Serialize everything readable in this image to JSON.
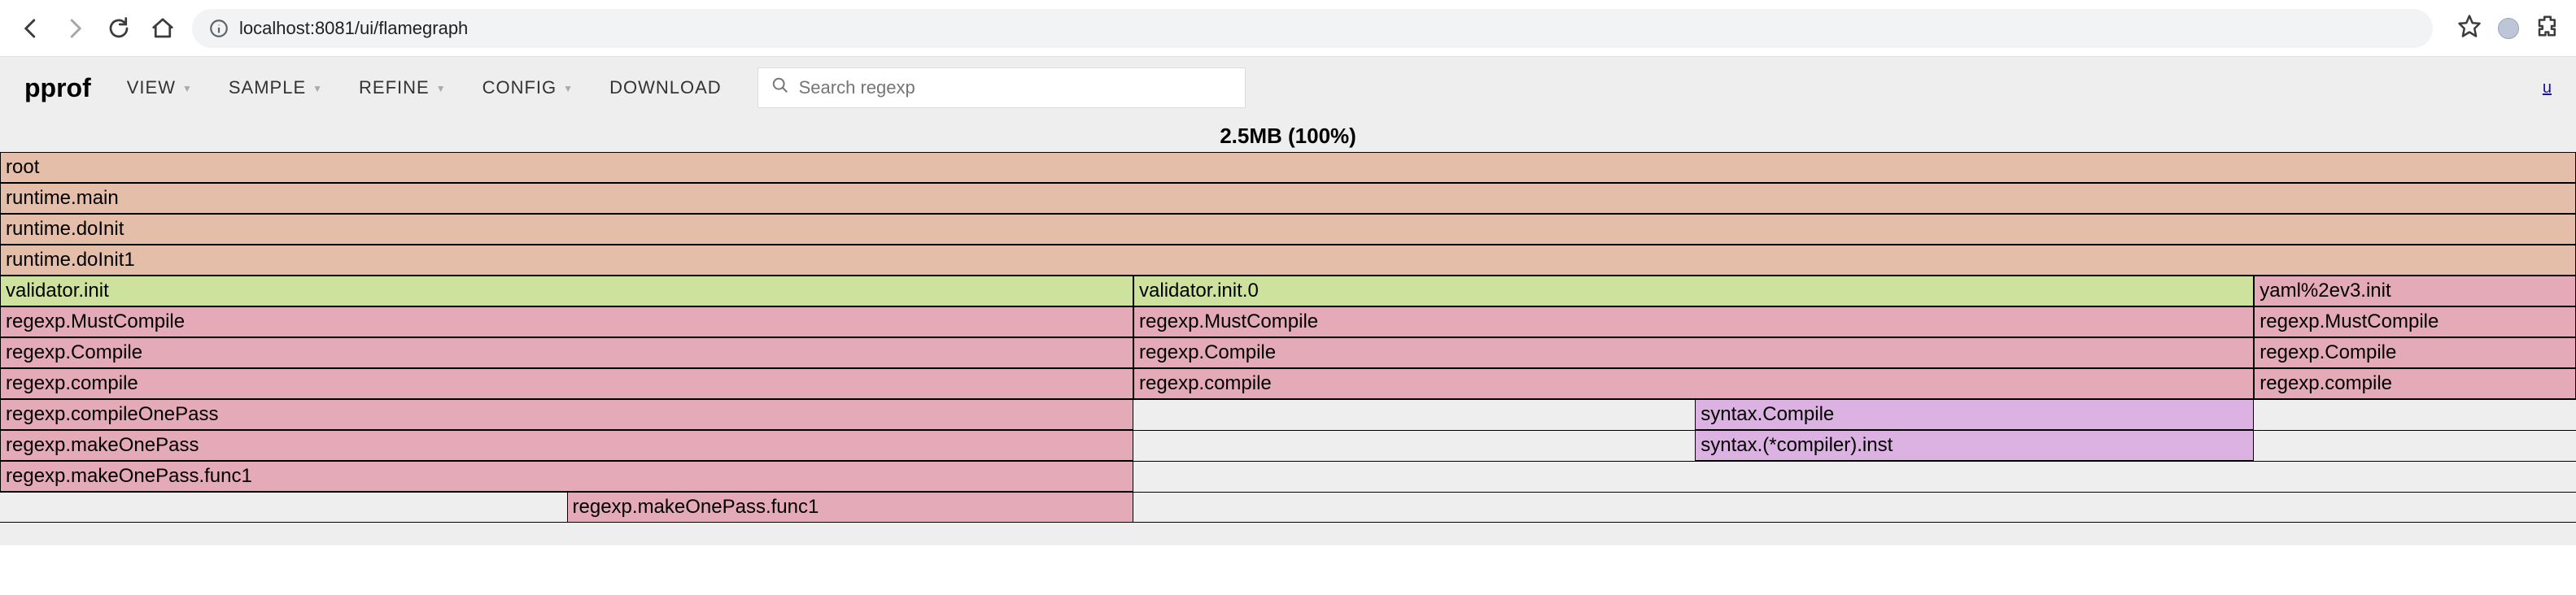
{
  "browser": {
    "url": "localhost:8081/ui/flamegraph"
  },
  "toolbar": {
    "title": "pprof",
    "menus": {
      "view": "VIEW",
      "sample": "SAMPLE",
      "refine": "REFINE",
      "config": "CONFIG",
      "download": "DOWNLOAD"
    },
    "search_placeholder": "Search regexp",
    "unit_link": "u"
  },
  "summary": "2.5MB (100%)",
  "chart_data": {
    "type": "flamegraph",
    "total_label": "2.5MB (100%)",
    "total_bytes_mb": 2.5,
    "x_range_pct": [
      0,
      100
    ],
    "rows": [
      [
        {
          "name": "root",
          "left_pct": 0.0,
          "width_pct": 100.0,
          "color": "tan"
        }
      ],
      [
        {
          "name": "runtime.main",
          "left_pct": 0.0,
          "width_pct": 100.0,
          "color": "tan"
        }
      ],
      [
        {
          "name": "runtime.doInit",
          "left_pct": 0.0,
          "width_pct": 100.0,
          "color": "tan"
        }
      ],
      [
        {
          "name": "runtime.doInit1",
          "left_pct": 0.0,
          "width_pct": 100.0,
          "color": "tan"
        }
      ],
      [
        {
          "name": "validator.init",
          "left_pct": 0.0,
          "width_pct": 44.0,
          "color": "green"
        },
        {
          "name": "validator.init.0",
          "left_pct": 44.0,
          "width_pct": 43.5,
          "color": "green"
        },
        {
          "name": "yaml%2ev3.init",
          "left_pct": 87.5,
          "width_pct": 12.5,
          "color": "pink"
        }
      ],
      [
        {
          "name": "regexp.MustCompile",
          "left_pct": 0.0,
          "width_pct": 44.0,
          "color": "pink"
        },
        {
          "name": "regexp.MustCompile",
          "left_pct": 44.0,
          "width_pct": 43.5,
          "color": "pink"
        },
        {
          "name": "regexp.MustCompile",
          "left_pct": 87.5,
          "width_pct": 12.5,
          "color": "pink"
        }
      ],
      [
        {
          "name": "regexp.Compile",
          "left_pct": 0.0,
          "width_pct": 44.0,
          "color": "pink"
        },
        {
          "name": "regexp.Compile",
          "left_pct": 44.0,
          "width_pct": 43.5,
          "color": "pink"
        },
        {
          "name": "regexp.Compile",
          "left_pct": 87.5,
          "width_pct": 12.5,
          "color": "pink"
        }
      ],
      [
        {
          "name": "regexp.compile",
          "left_pct": 0.0,
          "width_pct": 44.0,
          "color": "pink"
        },
        {
          "name": "regexp.compile",
          "left_pct": 44.0,
          "width_pct": 43.5,
          "color": "pink"
        },
        {
          "name": "regexp.compile",
          "left_pct": 87.5,
          "width_pct": 12.5,
          "color": "pink"
        }
      ],
      [
        {
          "name": "regexp.compileOnePass",
          "left_pct": 0.0,
          "width_pct": 44.0,
          "color": "pink"
        },
        {
          "name": "syntax.Compile",
          "left_pct": 65.8,
          "width_pct": 21.7,
          "color": "purp"
        }
      ],
      [
        {
          "name": "regexp.makeOnePass",
          "left_pct": 0.0,
          "width_pct": 44.0,
          "color": "pink"
        },
        {
          "name": "syntax.(*compiler).inst",
          "left_pct": 65.8,
          "width_pct": 21.7,
          "color": "purp"
        }
      ],
      [
        {
          "name": "regexp.makeOnePass.func1",
          "left_pct": 0.0,
          "width_pct": 44.0,
          "color": "pink"
        }
      ],
      [
        {
          "name": "regexp.makeOnePass.func1",
          "left_pct": 22.0,
          "width_pct": 22.0,
          "color": "pink"
        }
      ]
    ]
  }
}
